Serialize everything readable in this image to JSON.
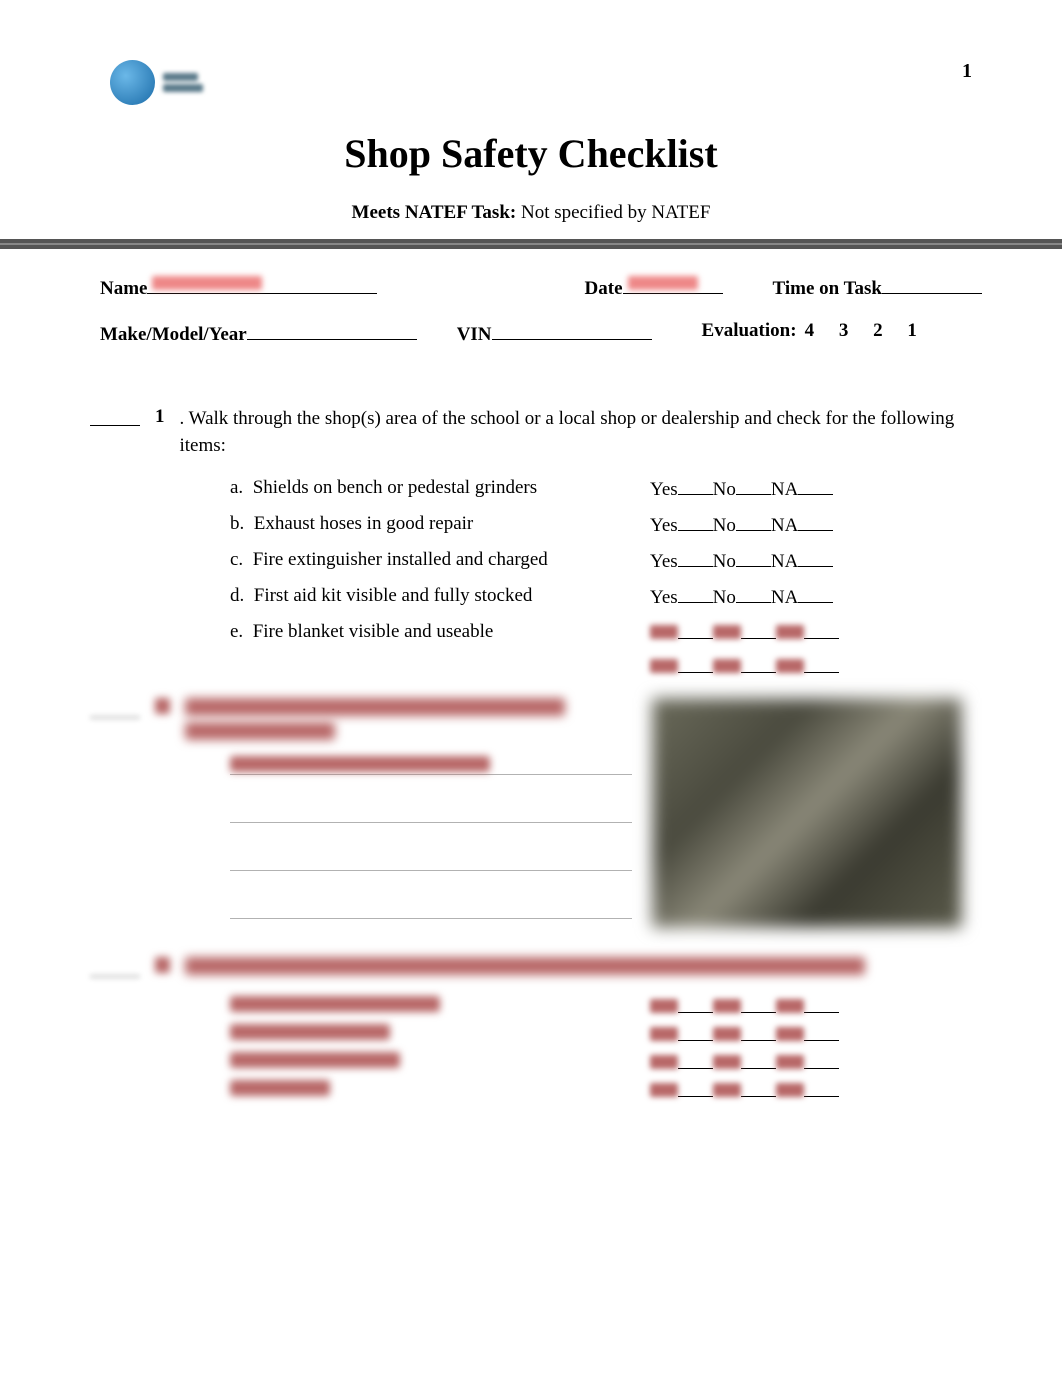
{
  "page_number": "1",
  "title": "Shop Safety Checklist",
  "subtitle_bold": "Meets NATEF Task:",
  "subtitle_rest": "  Not specified by NATEF",
  "form": {
    "name_label": "Name",
    "date_label": "Date",
    "time_label": "Time on Task",
    "mmy_label": "Make/Model/Year",
    "vin_label": "VIN",
    "eval_label": "Evaluation:",
    "eval_values": "4   3   2   1"
  },
  "q1": {
    "num": "1",
    "text": ".  Walk through the shop(s) area of the school or a local shop or dealership and check for the following items:",
    "items": [
      {
        "letter": "a.",
        "text": "Shields on bench or pedestal grinders"
      },
      {
        "letter": "b.",
        "text": "Exhaust hoses in good repair"
      },
      {
        "letter": "c.",
        "text": "Fire extinguisher installed and charged"
      },
      {
        "letter": "d.",
        "text": "First aid kit visible and fully stocked"
      },
      {
        "letter": "e.",
        "text": "Fire blanket visible and useable"
      }
    ]
  },
  "yn": {
    "yes": "Yes",
    "no": "No",
    "na": "NA"
  }
}
